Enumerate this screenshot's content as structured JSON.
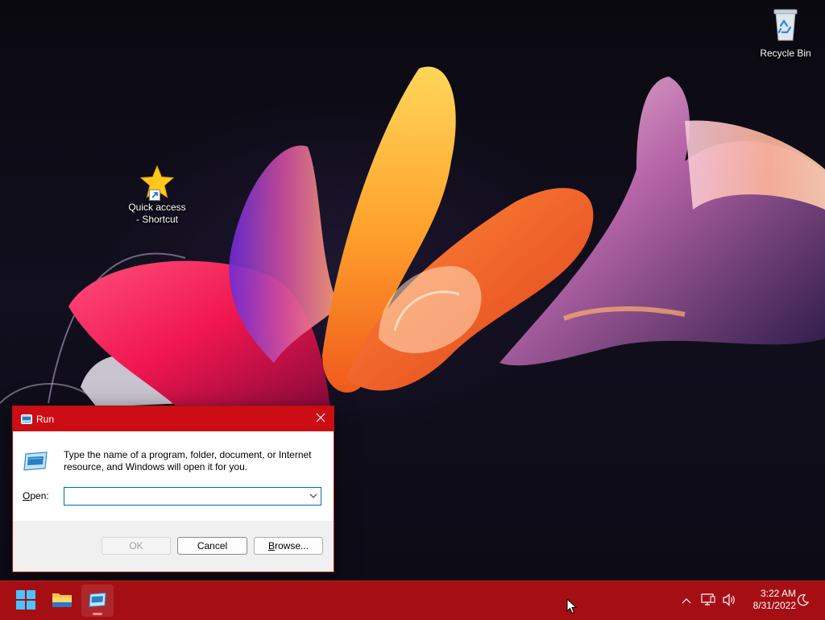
{
  "desktop": {
    "icons": [
      {
        "label": "Recycle Bin",
        "icon": "recycle-bin-icon"
      },
      {
        "label": "Quick access - Shortcut",
        "label_line1": "Quick access",
        "label_line2": "- Shortcut",
        "icon": "star-icon"
      }
    ]
  },
  "run_dialog": {
    "title": "Run",
    "description": "Type the name of a program, folder, document, or Internet resource, and Windows will open it for you.",
    "open_label_prefix": "",
    "open_label_accel": "O",
    "open_label_rest": "pen:",
    "open_value": "",
    "ok_label": "OK",
    "cancel_label": "Cancel",
    "browse_label_accel": "B",
    "browse_label_rest": "rowse..."
  },
  "taskbar": {
    "items": [
      {
        "name": "Start",
        "icon": "windows-start-icon"
      },
      {
        "name": "File Explorer",
        "icon": "folder-icon"
      },
      {
        "name": "Run",
        "icon": "run-icon",
        "active": true
      }
    ],
    "tray": {
      "icons": [
        "chevron-up-icon",
        "network-icon",
        "volume-icon",
        "focus-assist-icon"
      ],
      "time": "3:22 AM",
      "date": "8/31/2022"
    }
  },
  "colors": {
    "accent": "#cc0d14",
    "taskbar": "#a50f14",
    "input_border": "#0067c0"
  }
}
